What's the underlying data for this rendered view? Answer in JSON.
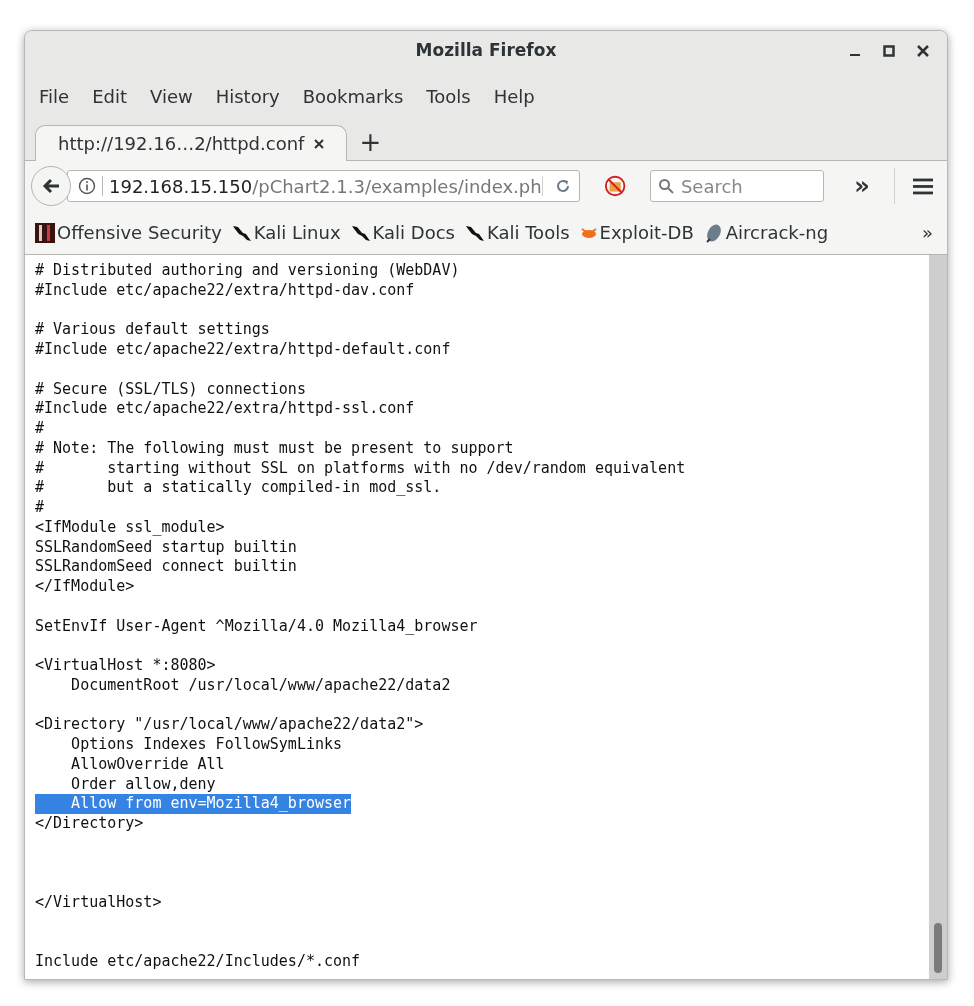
{
  "window": {
    "title": "Mozilla Firefox"
  },
  "menu": [
    {
      "label": "File"
    },
    {
      "label": "Edit"
    },
    {
      "label": "View"
    },
    {
      "label": "History"
    },
    {
      "label": "Bookmarks"
    },
    {
      "label": "Tools"
    },
    {
      "label": "Help"
    }
  ],
  "tabs": [
    {
      "label": "http://192.16…2/httpd.conf",
      "selected": true
    }
  ],
  "new_tab": "+",
  "address": {
    "host": "192.168.15.150",
    "path": "/pChart2.1.3/examples/index.ph"
  },
  "search": {
    "placeholder": "Search"
  },
  "overflow": "»",
  "bookmarks": [
    {
      "label": "Offensive Security",
      "kind": "offsec"
    },
    {
      "label": "Kali Linux",
      "kind": "kali"
    },
    {
      "label": "Kali Docs",
      "kind": "kali"
    },
    {
      "label": "Kali Tools",
      "kind": "kali"
    },
    {
      "label": "Exploit-DB",
      "kind": "exploit"
    },
    {
      "label": "Aircrack-ng",
      "kind": "aircrack"
    }
  ],
  "bookmarks_overflow": "»",
  "lines": [
    {
      "kind": "text",
      "text": "# Distributed authoring and versioning (WebDAV)",
      "selected": false
    },
    {
      "kind": "text",
      "text": "#Include etc/apache22/extra/httpd-dav.conf",
      "selected": false
    },
    {
      "kind": "blank"
    },
    {
      "kind": "text",
      "text": "# Various default settings",
      "selected": false
    },
    {
      "kind": "text",
      "text": "#Include etc/apache22/extra/httpd-default.conf",
      "selected": false
    },
    {
      "kind": "blank"
    },
    {
      "kind": "text",
      "text": "# Secure (SSL/TLS) connections",
      "selected": false
    },
    {
      "kind": "text",
      "text": "#Include etc/apache22/extra/httpd-ssl.conf",
      "selected": false
    },
    {
      "kind": "text",
      "text": "#",
      "selected": false
    },
    {
      "kind": "text",
      "text": "# Note: The following must must be present to support",
      "selected": false
    },
    {
      "kind": "text",
      "text": "#       starting without SSL on platforms with no /dev/random equivalent",
      "selected": false
    },
    {
      "kind": "text",
      "text": "#       but a statically compiled-in mod_ssl.",
      "selected": false
    },
    {
      "kind": "text",
      "text": "#",
      "selected": false
    },
    {
      "kind": "text",
      "text": "<IfModule ssl_module>",
      "selected": false
    },
    {
      "kind": "text",
      "text": "SSLRandomSeed startup builtin",
      "selected": false
    },
    {
      "kind": "text",
      "text": "SSLRandomSeed connect builtin",
      "selected": false
    },
    {
      "kind": "text",
      "text": "</IfModule>",
      "selected": false
    },
    {
      "kind": "blank"
    },
    {
      "kind": "text",
      "text": "SetEnvIf User-Agent ^Mozilla/4.0 Mozilla4_browser",
      "selected": false
    },
    {
      "kind": "blank"
    },
    {
      "kind": "text",
      "text": "<VirtualHost *:8080>",
      "selected": false
    },
    {
      "kind": "text",
      "text": "    DocumentRoot /usr/local/www/apache22/data2",
      "selected": false
    },
    {
      "kind": "blank"
    },
    {
      "kind": "text",
      "text": "<Directory \"/usr/local/www/apache22/data2\">",
      "selected": false
    },
    {
      "kind": "text",
      "text": "    Options Indexes FollowSymLinks",
      "selected": false
    },
    {
      "kind": "text",
      "text": "    AllowOverride All",
      "selected": false
    },
    {
      "kind": "text",
      "text": "    Order allow,deny",
      "selected": false
    },
    {
      "kind": "text",
      "text": "    Allow from env=Mozilla4_browser",
      "selected": true
    },
    {
      "kind": "text",
      "text": "</Directory>",
      "selected": false
    },
    {
      "kind": "blank"
    },
    {
      "kind": "blank"
    },
    {
      "kind": "blank"
    },
    {
      "kind": "text",
      "text": "</VirtualHost>",
      "selected": false
    },
    {
      "kind": "blank"
    },
    {
      "kind": "blank"
    },
    {
      "kind": "text",
      "text": "Include etc/apache22/Includes/*.conf",
      "selected": false
    }
  ]
}
